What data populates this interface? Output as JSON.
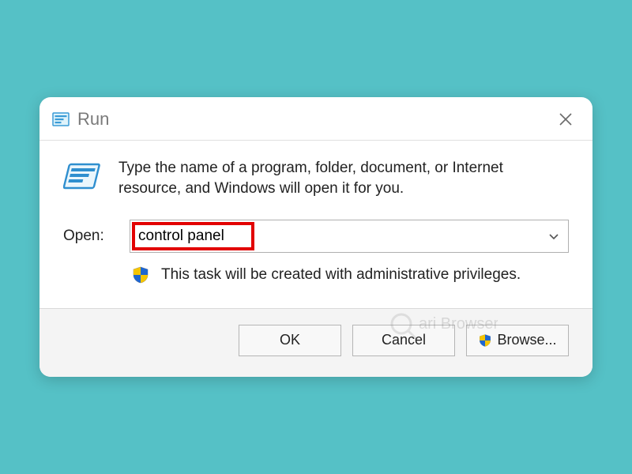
{
  "dialog": {
    "title": "Run",
    "description": "Type the name of a program, folder, document, or Internet resource, and Windows will open it for you.",
    "open_label": "Open:",
    "open_value": "control panel",
    "admin_note": "This task will be created with administrative privileges.",
    "buttons": {
      "ok": "OK",
      "cancel": "Cancel",
      "browse": "Browse..."
    }
  },
  "watermark": "ari Browser"
}
